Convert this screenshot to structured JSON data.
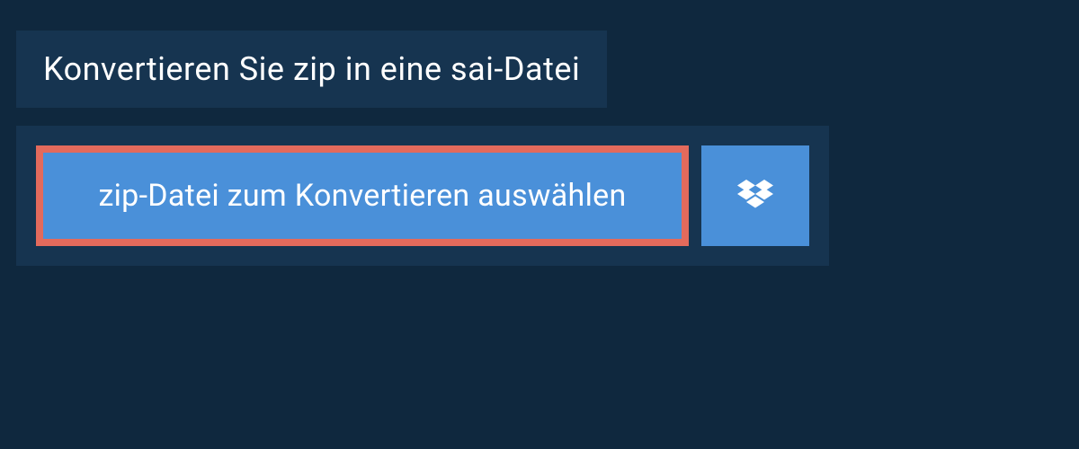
{
  "header": {
    "title": "Konvertieren Sie zip in eine sai-Datei"
  },
  "actions": {
    "select_file_label": "zip-Datei zum Konvertieren auswählen"
  }
}
